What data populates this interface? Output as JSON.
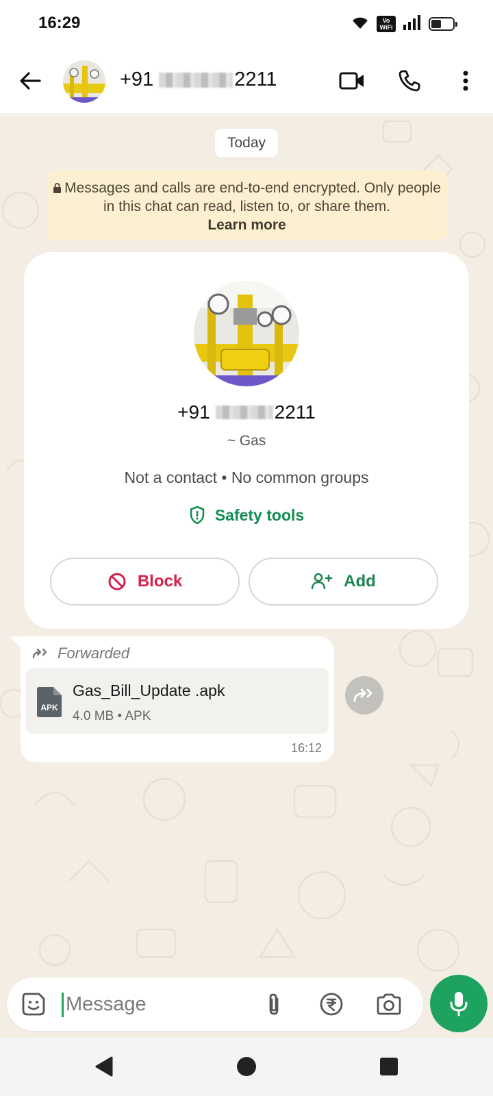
{
  "status_bar": {
    "time": "16:29",
    "network_badge": "Vo WiFi",
    "icons": [
      "wifi-icon",
      "vowifi-icon",
      "signal-icon",
      "battery-icon"
    ]
  },
  "header": {
    "contact_prefix": "+91",
    "contact_suffix": "2211",
    "icons": [
      "back-arrow-icon",
      "video-call-icon",
      "voice-call-icon",
      "more-vert-icon"
    ]
  },
  "chat": {
    "date_label": "Today",
    "encryption": {
      "text": "Messages and calls are end-to-end encrypted. Only people in this chat can read, listen to, or share them.",
      "link": "Learn more"
    },
    "contact_card": {
      "phone_prefix": "+91",
      "phone_suffix": "2211",
      "subtitle": "~ Gas",
      "info": "Not a contact • No common groups",
      "safety_label": "Safety tools",
      "block_label": "Block",
      "add_label": "Add"
    },
    "message": {
      "forwarded_label": "Forwarded",
      "file_type_badge": "APK",
      "file_name": "Gas_Bill_Update .apk",
      "file_meta": "4.0 MB • APK",
      "time": "16:12"
    }
  },
  "composer": {
    "placeholder": "Message"
  },
  "colors": {
    "accent": "#1da35f",
    "danger": "#d6204b",
    "chat_bg": "#f3ede4",
    "encryption_bg": "#fdf0d1"
  }
}
